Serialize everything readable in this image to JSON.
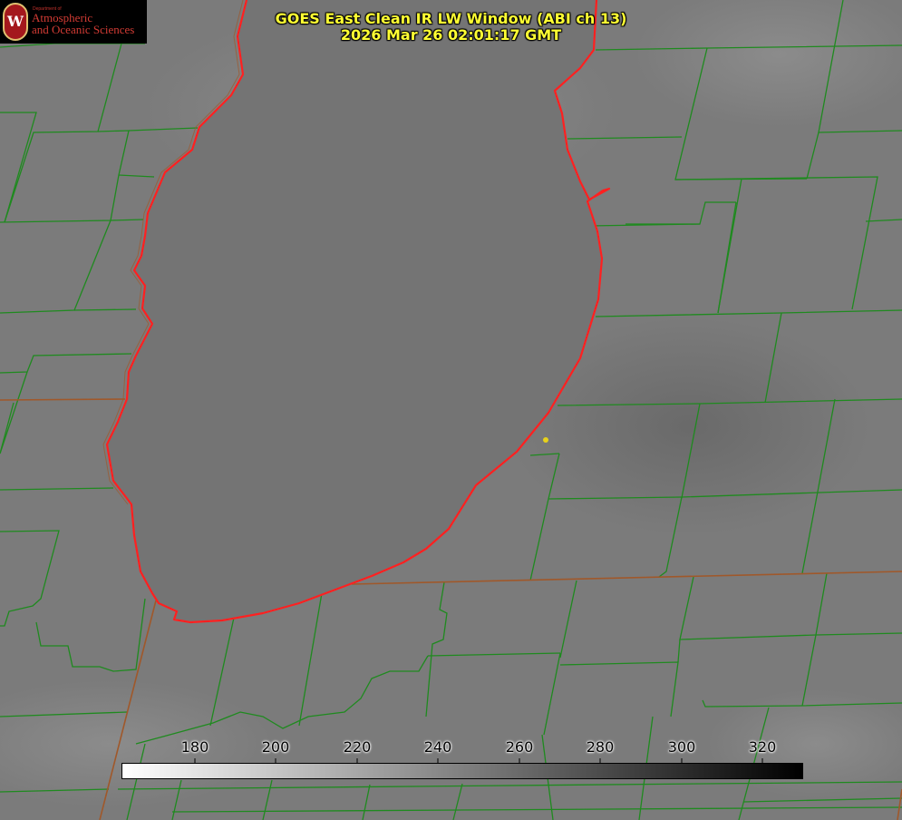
{
  "title": {
    "line1": "GOES East Clean IR LW Window (ABI ch 13)",
    "line2": "2026 Mar 26 02:01:17 GMT"
  },
  "logo": {
    "dept": "Department of",
    "line1": "Atmospheric",
    "line2": "and Oceanic Sciences",
    "seal_letter": "W"
  },
  "colorbar": {
    "ticks": [
      "180",
      "200",
      "220",
      "240",
      "260",
      "280",
      "300",
      "320"
    ],
    "colors": {
      "low": "#ffffff",
      "high": "#000000"
    }
  },
  "colors": {
    "county_lines": "#1f8a1f",
    "state_lines": "#a0582a",
    "lake_outline": "#ff2020",
    "marker": "#e8d21a"
  }
}
